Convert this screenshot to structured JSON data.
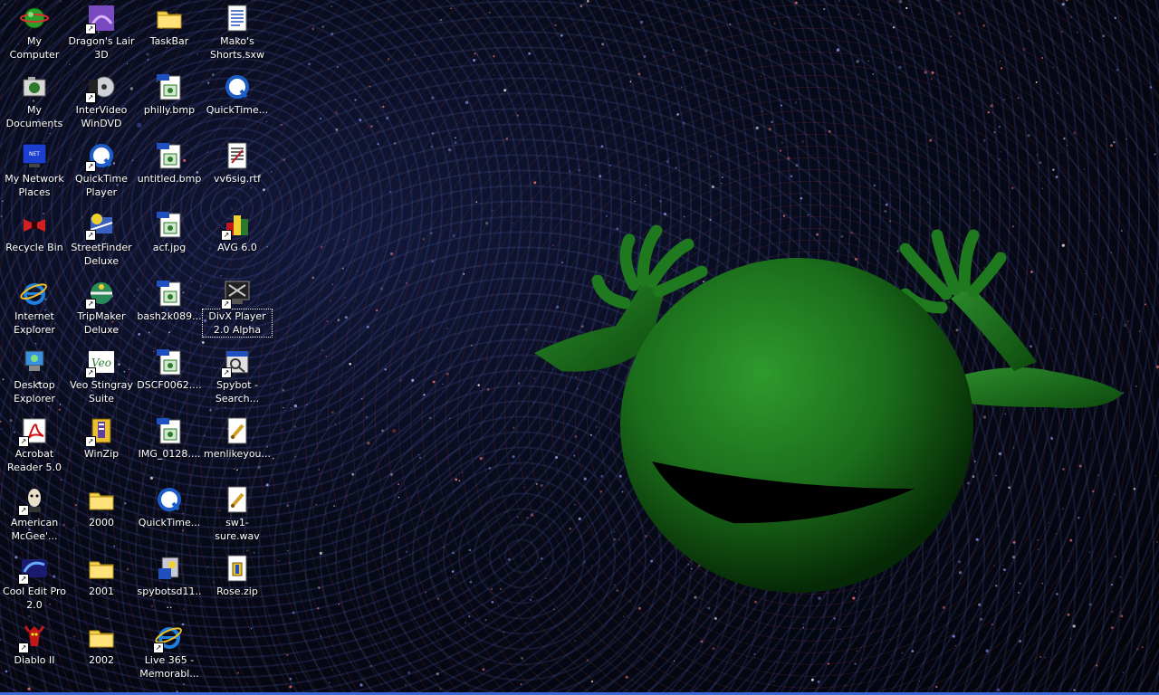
{
  "desktop": {
    "icons": [
      {
        "label": "My Computer",
        "icon": "my-computer-icon",
        "shortcut": false
      },
      {
        "label": "My Documents",
        "icon": "my-documents-icon",
        "shortcut": false
      },
      {
        "label": "My Network Places",
        "icon": "network-places-icon",
        "shortcut": false
      },
      {
        "label": "Recycle Bin",
        "icon": "recycle-bin-icon",
        "shortcut": false
      },
      {
        "label": "Internet Explorer",
        "icon": "internet-explorer-icon",
        "shortcut": false
      },
      {
        "label": "Desktop Explorer",
        "icon": "desktop-explorer-icon",
        "shortcut": false
      },
      {
        "label": "Acrobat Reader 5.0",
        "icon": "acrobat-icon",
        "shortcut": true
      },
      {
        "label": "American McGee'...",
        "icon": "american-mcgee-icon",
        "shortcut": true
      },
      {
        "label": "Cool Edit Pro 2.0",
        "icon": "cool-edit-icon",
        "shortcut": true
      },
      {
        "label": "Diablo II",
        "icon": "diablo-icon",
        "shortcut": true
      },
      {
        "label": "Dragon's Lair 3D",
        "icon": "dragons-lair-icon",
        "shortcut": true
      },
      {
        "label": "InterVideo WinDVD",
        "icon": "windvd-icon",
        "shortcut": true
      },
      {
        "label": "QuickTime Player",
        "icon": "quicktime-icon",
        "shortcut": true
      },
      {
        "label": "StreetFinder Deluxe",
        "icon": "streetfinder-icon",
        "shortcut": true
      },
      {
        "label": "TripMaker Deluxe",
        "icon": "tripmaker-icon",
        "shortcut": true
      },
      {
        "label": "Veo Stingray Suite",
        "icon": "veo-icon",
        "shortcut": true
      },
      {
        "label": "WinZip",
        "icon": "winzip-icon",
        "shortcut": true
      },
      {
        "label": "2000",
        "icon": "folder-icon",
        "shortcut": false
      },
      {
        "label": "2001",
        "icon": "folder-icon",
        "shortcut": false
      },
      {
        "label": "2002",
        "icon": "folder-icon",
        "shortcut": false
      },
      {
        "label": "TaskBar",
        "icon": "folder-icon",
        "shortcut": false
      },
      {
        "label": "philly.bmp",
        "icon": "bmp-file-icon",
        "shortcut": false
      },
      {
        "label": "untitled.bmp",
        "icon": "bmp-file-icon",
        "shortcut": false
      },
      {
        "label": "acf.jpg",
        "icon": "jpg-file-icon",
        "shortcut": false
      },
      {
        "label": "bash2k089....",
        "icon": "jpg-file-icon",
        "shortcut": false
      },
      {
        "label": "DSCF0062....",
        "icon": "jpg-file-icon",
        "shortcut": false
      },
      {
        "label": "IMG_0128....",
        "icon": "jpg-file-icon",
        "shortcut": false
      },
      {
        "label": "QuickTime...",
        "icon": "quicktime-installer-icon",
        "shortcut": false
      },
      {
        "label": "spybotsd11....",
        "icon": "installer-icon",
        "shortcut": false
      },
      {
        "label": "Live 365 - Memorabl...",
        "icon": "ie-shortcut-icon",
        "shortcut": true
      },
      {
        "label": "Mako's Shorts.sxw",
        "icon": "document-icon",
        "shortcut": false
      },
      {
        "label": "QuickTime...",
        "icon": "quicktime-file-icon",
        "shortcut": false
      },
      {
        "label": "vv6sig.rtf",
        "icon": "rtf-file-icon",
        "shortcut": false
      },
      {
        "label": "AVG 6.0",
        "icon": "avg-icon",
        "shortcut": true
      },
      {
        "label": "DivX Player 2.0 Alpha",
        "icon": "divx-icon",
        "shortcut": true,
        "focused": true
      },
      {
        "label": "Spybot - Search...",
        "icon": "spybot-icon",
        "shortcut": true
      },
      {
        "label": "menlikeyou....",
        "icon": "audio-file-icon",
        "shortcut": false
      },
      {
        "label": "sw1-sure.wav",
        "icon": "audio-file-icon",
        "shortcut": false
      },
      {
        "label": "Rose.zip",
        "icon": "zip-file-icon",
        "shortcut": false
      }
    ]
  },
  "colors": {
    "label_text": "#ffffff",
    "creature_green": "#1f7a1f",
    "folder_yellow": "#f5d24a",
    "taskbar_blue": "#3a6ad8"
  }
}
